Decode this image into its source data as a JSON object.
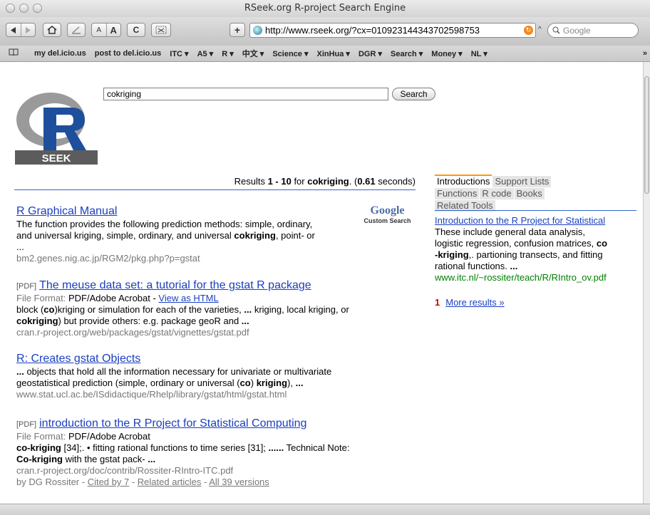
{
  "window": {
    "title": "RSeek.org R-project Search Engine"
  },
  "toolbar": {
    "text_small": "A",
    "text_large": "A",
    "reload": "C",
    "add": "+",
    "url": "http://www.rseek.org/?cx=010923144343702598753",
    "search_placeholder": "Google"
  },
  "bookmarks": [
    "my del.icio.us",
    "post to del.icio.us",
    "ITC ▾",
    "A5 ▾",
    "R ▾",
    "中文 ▾",
    "Science ▾",
    "XinHua ▾",
    "DGR ▾",
    "Search ▾",
    "Money ▾",
    "NL ▾"
  ],
  "overflow": "»",
  "logo": {
    "text": "SEEK",
    "letter": "R",
    "colors": {
      "bar": "#5c5c5c",
      "r": "#1e4f9c"
    }
  },
  "search": {
    "query": "cokriging",
    "button": "Search"
  },
  "results_info": {
    "pre": "Results ",
    "range": "1 - 10",
    "for": " for ",
    "term": "cokriging",
    "dot": ". (",
    "time": "0.61",
    "post": " seconds)"
  },
  "gcs": {
    "google": "Google",
    "custom": "Custom Search"
  },
  "results": [
    {
      "pdf": "",
      "title": "R Graphical Manual",
      "snippet_1": "The function provides the following prediction methods: simple, ordinary,",
      "snippet_2a": "and universal kriging, simple, ordinary, and universal ",
      "snippet_2b": "cokriging",
      "snippet_2c": ", point- or",
      "snippet_3": "...",
      "url": "bm2.genes.nig.ac.jp/RGM2/pkg.php?p=gstat"
    },
    {
      "pdf": "[PDF]",
      "title": "The meuse data set: a tutorial for the gstat R package",
      "format_label": "File Format: ",
      "format": "PDF/Adobe Acrobat - ",
      "view_html": "View as HTML",
      "snippet_1a": "block (",
      "snippet_1b": "co",
      "snippet_1c": ")kriging or simulation for each of the varieties, ",
      "snippet_1d": "...",
      "snippet_1e": " kriging, local kriging, or",
      "snippet_2a": "cokriging",
      "snippet_2b": ") but provide others: e.g. package geoR and ",
      "snippet_2c": "...",
      "url": "cran.r-project.org/web/packages/gstat/vignettes/gstat.pdf"
    },
    {
      "title": "R: Creates gstat Objects",
      "snippet_1a": "...",
      "snippet_1b": " objects that hold all the information necessary for univariate or multivariate",
      "snippet_2a": "geostatistical prediction (simple, ordinary or universal (",
      "snippet_2b": "co",
      "snippet_2c": ") ",
      "snippet_2d": "kriging",
      "snippet_2e": "), ",
      "snippet_2f": "...",
      "url": "www.stat.ucl.ac.be/ISdidactique/Rhelp/library/gstat/html/gstat.html"
    },
    {
      "pdf": "[PDF]",
      "title": "introduction to the R Project for Statistical Computing",
      "format_label": "File Format: ",
      "format": "PDF/Adobe Acrobat",
      "snippet_1a": "co-kriging",
      "snippet_1b": " [34];. • fitting rational functions to time series [31]; ",
      "snippet_1c": "......",
      "snippet_1d": " Technical Note:",
      "snippet_2a": "Co-kriging",
      "snippet_2b": " with the gstat pack- ",
      "snippet_2c": "...",
      "url": "cran.r-project.org/doc/contrib/Rossiter-RIntro-ITC.pdf",
      "by": "by DG Rossiter - ",
      "cited": "Cited by 7",
      "sep1": " - ",
      "related": "Related articles",
      "sep2": " - ",
      "versions": "All 39 versions"
    }
  ],
  "side_tabs": [
    "Introductions",
    "Support Lists",
    "Functions",
    "R code",
    "Books",
    "Related Tools"
  ],
  "side": {
    "title": "Introduction to the R Project for Statistical",
    "s1": "These include general data analysis,",
    "s2a": "logistic regression, confusion matrices, ",
    "s2b": "co",
    "s3a": "-kriging",
    "s3b": ",. partioning transects, and fitting",
    "s4": "rational functions. ",
    "s4b": "...",
    "url": "www.itc.nl/~rossiter/teach/R/RIntro_ov.pdf",
    "more_num": "1",
    "more": "More results »"
  }
}
